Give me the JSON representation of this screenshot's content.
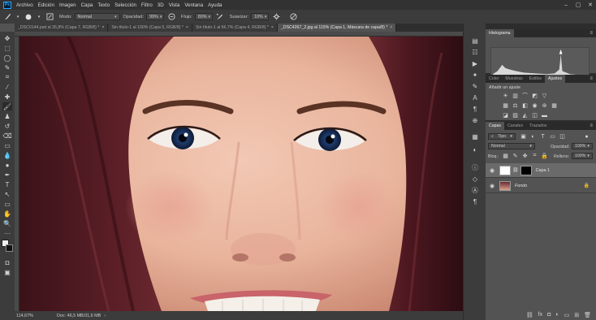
{
  "menubar": {
    "logo": "Ps",
    "items": [
      "Archivo",
      "Edición",
      "Imagen",
      "Capa",
      "Texto",
      "Selección",
      "Filtro",
      "3D",
      "Vista",
      "Ventana",
      "Ayuda"
    ],
    "window_controls": [
      "–",
      "▢",
      "✕"
    ]
  },
  "options": {
    "mode_label": "Modo:",
    "mode_value": "Normal",
    "opacity_label": "Opacidad:",
    "opacity_value": "99%",
    "flow_label": "Flujo:",
    "flow_value": "80%",
    "smooth_label": "Suavizar:",
    "smooth_value": "10%"
  },
  "tabs": [
    {
      "label": "_DSC0144.psd al 26,8% (Capa 7, RGB/8) *",
      "close": "×",
      "active": false
    },
    {
      "label": "Sin título-1 al 100% (Capa 5, RGB/8) *",
      "close": "×",
      "active": false
    },
    {
      "label": "Sin título-1 al 66,7% (Capa 4, RGB/8) *",
      "close": "×",
      "active": false
    },
    {
      "label": "_DSC4267_2.jpg al 115% (Capa 1, Máscara de capa/8) *",
      "close": "×",
      "active": true
    }
  ],
  "status": {
    "zoom": "114,67%",
    "doc": "Doc: 46,5 MB/31,6 MB",
    "arrow": "›"
  },
  "panels": {
    "histogram_tab": "Histograma",
    "adjust_tabs": [
      "Color",
      "Muestras",
      "Estilos",
      "Ajustes"
    ],
    "adjust_active": "Ajustes",
    "adjust_label": "Añadir un ajuste",
    "layer_tabs": [
      "Capas",
      "Canales",
      "Trazados"
    ],
    "layer_active": "Capas",
    "filter_value": "Tipo",
    "blend_value": "Normal",
    "opacity_label": "Opacidad:",
    "opacity_value": "100%",
    "lock_label": "Bloq.:",
    "fill_label": "Relleno:",
    "fill_value": "100%",
    "layers": [
      {
        "name": "Capa 1",
        "italic": false,
        "selected": true
      },
      {
        "name": "Fondo",
        "italic": true,
        "selected": false
      }
    ]
  },
  "colors": {
    "ui_dark": "#323232",
    "ui_mid": "#535353",
    "accent": "#31a8ff"
  }
}
